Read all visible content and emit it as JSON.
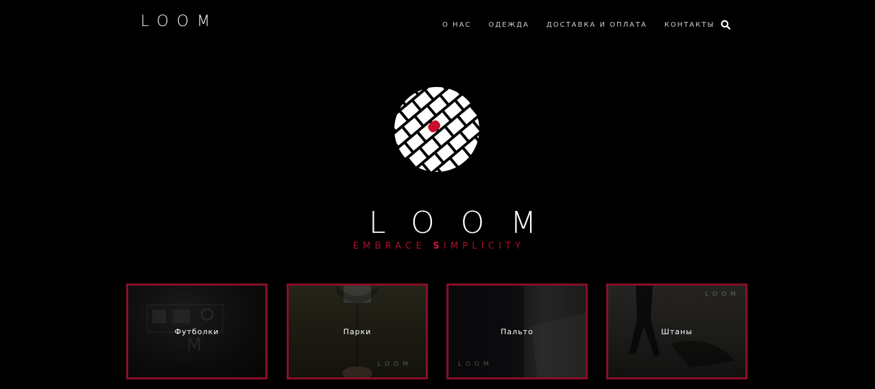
{
  "header": {
    "logo": "LOOM",
    "nav": [
      {
        "label": "О НАС"
      },
      {
        "label": "ОДЕЖДА"
      },
      {
        "label": "ДОСТАВКА И ОПЛАТА"
      },
      {
        "label": "КОНТАКТЫ"
      }
    ],
    "search_icon": "search-icon"
  },
  "hero": {
    "emblem_icon": "woven-circle-logo",
    "title": "LOOM",
    "tagline_part1": "EMBRACE ",
    "tagline_strong": "S",
    "tagline_part2": "IMPLICITY"
  },
  "categories": [
    {
      "label": "Футболки"
    },
    {
      "label": "Парки",
      "watermark": "LOOM"
    },
    {
      "label": "Пальто",
      "watermark": "LOOM"
    },
    {
      "label": "Штаны",
      "watermark": "LOOM"
    }
  ],
  "colors": {
    "background": "#000000",
    "accent": "#b0102f",
    "card_border": "#8a0f26",
    "text": "#ffffff"
  }
}
